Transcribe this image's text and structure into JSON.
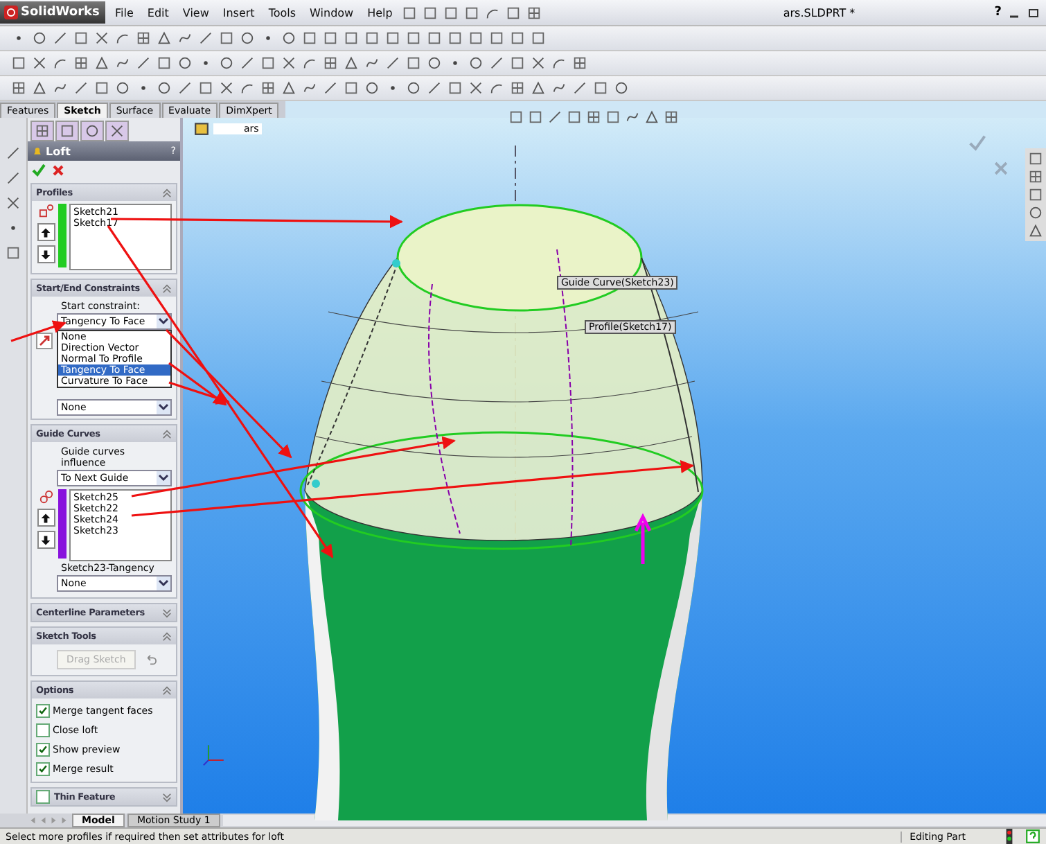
{
  "app": {
    "logo": "SolidWorks",
    "menu": [
      "File",
      "Edit",
      "View",
      "Insert",
      "Tools",
      "Window",
      "Help"
    ],
    "document_title": "ars.SLDPRT *",
    "help": "?"
  },
  "command_tabs": [
    {
      "label": "Features",
      "selected": false
    },
    {
      "label": "Sketch",
      "selected": true
    },
    {
      "label": "Surface",
      "selected": false
    },
    {
      "label": "Evaluate",
      "selected": false
    },
    {
      "label": "DimXpert",
      "selected": false
    }
  ],
  "feature_tree": {
    "root": "ars"
  },
  "property_manager": {
    "title": "Loft",
    "help": "?",
    "sections": [
      {
        "kind": "list",
        "title": "Profiles",
        "expanded": true,
        "color": "#22cc22",
        "items": [
          "Sketch21",
          "Sketch17"
        ]
      },
      {
        "kind": "constraints",
        "title": "Start/End Constraints",
        "expanded": true,
        "label": "Start constraint:",
        "value": "Tangency To Face",
        "options": [
          {
            "label": "None",
            "selected": false
          },
          {
            "label": "Direction Vector",
            "selected": false
          },
          {
            "label": "Normal To Profile",
            "selected": false
          },
          {
            "label": "Tangency To Face",
            "selected": true
          },
          {
            "label": "Curvature To Face",
            "selected": false
          }
        ],
        "second_value": "None"
      },
      {
        "kind": "guides",
        "title": "Guide Curves",
        "expanded": true,
        "label": "Guide curves influence",
        "value": "To Next Guide",
        "color": "#8811dd",
        "items": [
          "Sketch25",
          "Sketch22",
          "Sketch24",
          "Sketch23"
        ],
        "tangency_label": "Sketch23-Tangency",
        "tangency_value": "None"
      },
      {
        "kind": "header",
        "title": "Centerline Parameters",
        "expanded": false
      },
      {
        "kind": "button",
        "title": "Sketch Tools",
        "expanded": true,
        "button": "Drag Sketch",
        "disabled": true
      },
      {
        "kind": "checks",
        "title": "Options",
        "expanded": true,
        "items": [
          {
            "label": "Merge tangent faces",
            "checked": true
          },
          {
            "label": "Close loft",
            "checked": false
          },
          {
            "label": "Show preview",
            "checked": true
          },
          {
            "label": "Merge result",
            "checked": true
          }
        ]
      },
      {
        "kind": "check_header",
        "title": "Thin Feature",
        "expanded": false,
        "checked": false
      }
    ]
  },
  "viewport": {
    "callouts": [
      "Guide Curve(Sketch23)",
      "Profile(Sketch17)"
    ]
  },
  "bottom_tabs": [
    {
      "label": "Model",
      "selected": true
    },
    {
      "label": "Motion Study 1",
      "selected": false
    }
  ],
  "status_bar": {
    "message": "Select more profiles if required then set attributes for loft",
    "mode": "Editing Part"
  }
}
